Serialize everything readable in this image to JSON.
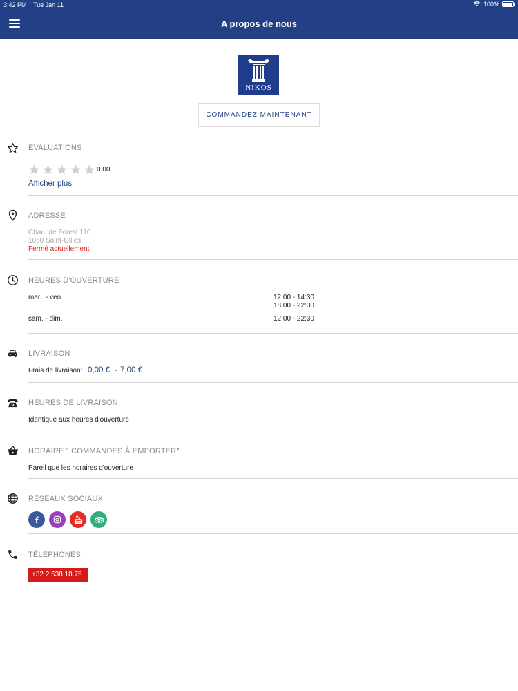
{
  "status_bar": {
    "time": "3:42 PM",
    "date": "Tue Jan 11",
    "battery": "100%"
  },
  "nav": {
    "title": "A propos de nous"
  },
  "logo": {
    "text": "NIKOS"
  },
  "order_button": {
    "label": "COMMANDEZ MAINTENANT"
  },
  "ratings": {
    "title": "EVALUATIONS",
    "score": "0.00",
    "star_count": 5,
    "more_link": "Afficher plus"
  },
  "address": {
    "title": "ADRESSE",
    "line1": "Chau. de Forest 110",
    "line2": "1060 Saint-Gilles",
    "status": "Fermé actuellement"
  },
  "hours": {
    "title": "HEURES D'OUVERTURE",
    "rows": [
      {
        "days": "mar.. - ven.",
        "times": [
          "12:00 - 14:30",
          "18:00 - 22:30"
        ]
      },
      {
        "days": "sam. - dim.",
        "times": [
          "12:00 - 22:30"
        ]
      }
    ]
  },
  "delivery": {
    "title": "LIVRAISON",
    "fee_label": "Frais de livraison:",
    "fee_min": "0,00 €",
    "fee_sep": "-",
    "fee_max": "7,00 €"
  },
  "delivery_hours": {
    "title": "HEURES DE LIVRAISON",
    "text": "Identique aux heures d'ouverture"
  },
  "takeaway": {
    "title": "HORAIRE \" COMMANDES À EMPORTER\"",
    "text": "Pareil que les horaires d'ouverture"
  },
  "social": {
    "title": "RÉSEAUX SOCIAUX",
    "items": [
      {
        "name": "facebook",
        "icon": "facebook-icon",
        "color": "#3b5998"
      },
      {
        "name": "instagram",
        "icon": "instagram-icon",
        "color": "#9b3fc0"
      },
      {
        "name": "youtube",
        "icon": "youtube-icon",
        "color": "#e52d27"
      },
      {
        "name": "tripadvisor",
        "icon": "tripadvisor-icon",
        "color": "#2eaf7d"
      }
    ]
  },
  "phones": {
    "title": "TÉLÉPHONES",
    "number": "+32 2 538 18 75"
  },
  "colors": {
    "brand": "#233f85",
    "closed": "#e02020",
    "phone_bg": "#d51a1a",
    "divider": "#d6d6d6"
  }
}
